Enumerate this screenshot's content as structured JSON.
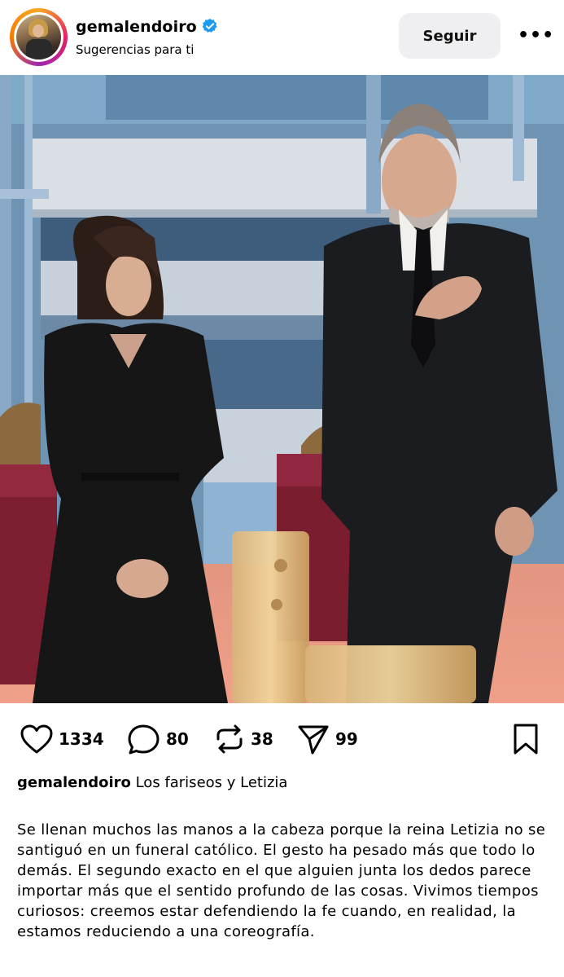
{
  "header": {
    "username": "gemalendoiro",
    "subtitle": "Sugerencias para ti",
    "follow_label": "Seguir",
    "more_label": "•••"
  },
  "actions": {
    "likes": "1334",
    "comments": "80",
    "reposts": "38",
    "shares": "99"
  },
  "caption": {
    "username": "gemalendoiro",
    "title": "Los fariseos y Letizia"
  },
  "body": "Se llenan muchos las manos a la cabeza porque la reina Letizia no se santiguó en un funeral católico. El gesto ha pesado más que todo lo demás. El segundo exacto en el que alguien junta los dedos parece importar más que el sentido profundo de las cosas. Vivimos tiempos curiosos: creemos estar defendiendo la fe cuando, en realidad, la estamos reduciendo a una coreografía.",
  "icons": [
    "verified-icon",
    "heart-icon",
    "comment-icon",
    "repost-icon",
    "share-icon",
    "bookmark-icon",
    "more-icon"
  ],
  "colors": {
    "verified": "#1d9bf0",
    "follow_bg": "#efeff1"
  }
}
